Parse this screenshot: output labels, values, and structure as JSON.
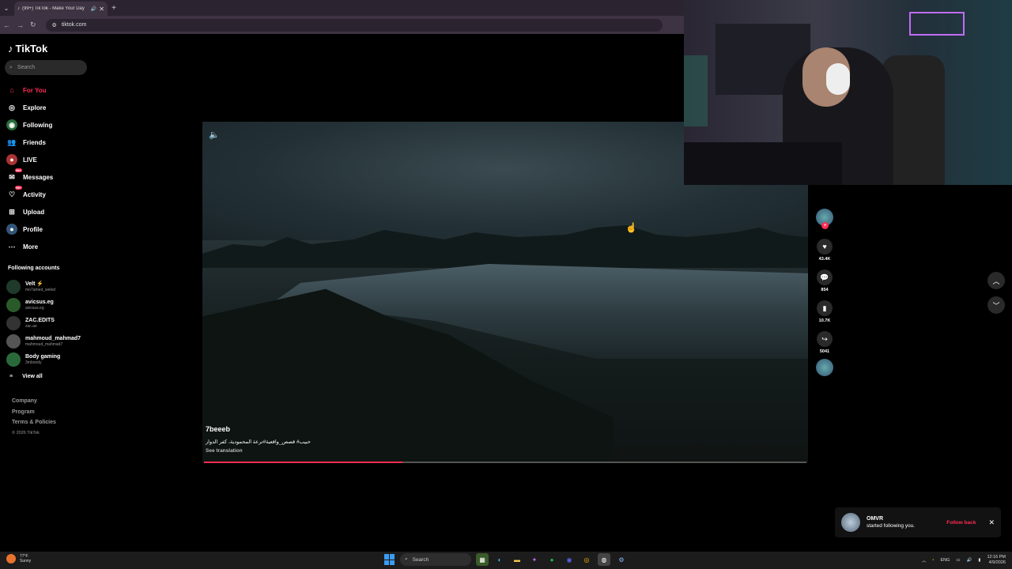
{
  "browser": {
    "tab_title": "(99+) TikTok - Make Your Day",
    "url": "tiktok.com"
  },
  "sidebar": {
    "logo": "TikTok",
    "search_placeholder": "Search",
    "nav": [
      {
        "label": "For You",
        "icon": "home-icon"
      },
      {
        "label": "Explore",
        "icon": "compass-icon"
      },
      {
        "label": "Following",
        "icon": "following-icon"
      },
      {
        "label": "Friends",
        "icon": "friends-icon"
      },
      {
        "label": "LIVE",
        "icon": "live-icon"
      },
      {
        "label": "Messages",
        "icon": "messages-icon",
        "badge": "99+"
      },
      {
        "label": "Activity",
        "icon": "activity-icon",
        "badge": "99+"
      },
      {
        "label": "Upload",
        "icon": "upload-icon"
      },
      {
        "label": "Profile",
        "icon": "profile-icon"
      },
      {
        "label": "More",
        "icon": "more-icon"
      }
    ],
    "following_title": "Following accounts",
    "accounts": [
      {
        "name": "Velt ⚡",
        "handle": "mo7amed_weled",
        "color": "#1f3a2a"
      },
      {
        "name": "avicsus.eg",
        "handle": "avicsus.eg",
        "color": "#2a5a2a"
      },
      {
        "name": "ZAC.EDITS",
        "handle": "zac.ae",
        "color": "#333"
      },
      {
        "name": "mahmoud_mahmad7",
        "handle": "mahmoud_mahmad7",
        "color": "#555"
      },
      {
        "name": "Body gaming",
        "handle": "3mboody",
        "color": "#2a6a3a"
      }
    ],
    "view_all": "View all",
    "footer": [
      "Company",
      "Program",
      "Terms & Policies"
    ],
    "copyright": "© 2026 TikTok"
  },
  "video": {
    "author": "7beeeb",
    "description": "حبيب# قصص_واقعية#ترعة المحمودية، كفر الدوار",
    "see_translation": "See translation",
    "progress": 0.33
  },
  "actions": {
    "likes": "43.4K",
    "comments": "854",
    "saves": "10.7K",
    "shares": "5041"
  },
  "notification": {
    "name": "OMVR",
    "message": "started following you.",
    "action": "Follow back"
  },
  "taskbar": {
    "temp": "77°F",
    "weather": "Sunny",
    "search": "Search",
    "lang": "ENG",
    "time": "12:16 PM",
    "date": "4/9/2026"
  }
}
